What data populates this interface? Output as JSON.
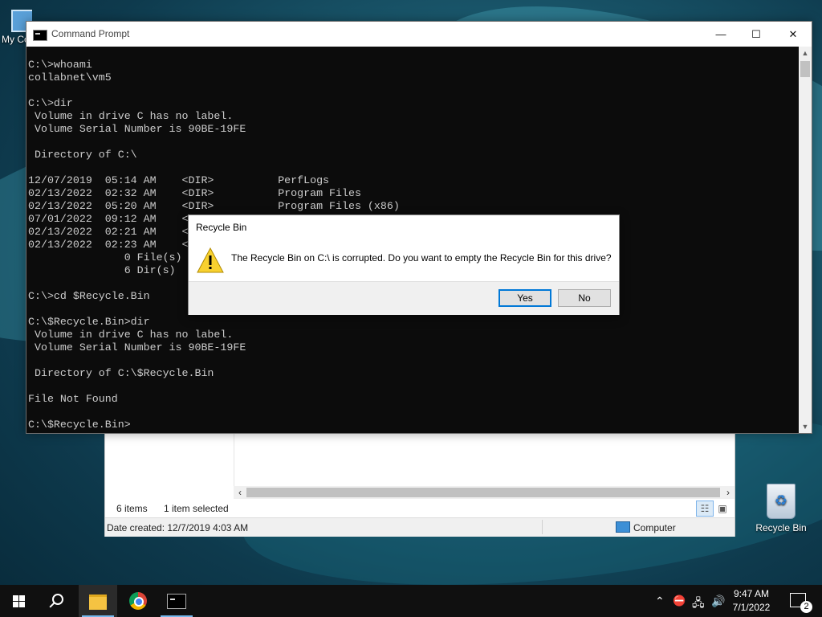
{
  "desktop": {
    "icons": [
      {
        "label": "My Co"
      },
      {
        "label": "Recycle Bin"
      }
    ]
  },
  "explorer": {
    "status_items": "6 items",
    "status_selected": "1 item selected",
    "date_created": "Date created: 12/7/2019 4:03 AM",
    "location": "Computer"
  },
  "cmd": {
    "title": "Command Prompt",
    "console_text": "C:\\>whoami\ncollabnet\\vm5\n\nC:\\>dir\n Volume in drive C has no label.\n Volume Serial Number is 90BE-19FE\n\n Directory of C:\\\n\n12/07/2019  05:14 AM    <DIR>          PerfLogs\n02/13/2022  02:32 AM    <DIR>          Program Files\n02/13/2022  05:20 AM    <DIR>          Program Files (x86)\n07/01/2022  09:12 AM    <\n02/13/2022  02:21 AM    <\n02/13/2022  02:23 AM    <\n               0 File(s)\n               6 Dir(s)\n\nC:\\>cd $Recycle.Bin\n\nC:\\$Recycle.Bin>dir\n Volume in drive C has no label.\n Volume Serial Number is 90BE-19FE\n\n Directory of C:\\$Recycle.Bin\n\nFile Not Found\n\nC:\\$Recycle.Bin>"
  },
  "dialog": {
    "title": "Recycle Bin",
    "message": "The Recycle Bin on C:\\ is corrupted. Do you want to empty the Recycle Bin for this drive?",
    "yes_label": "Yes",
    "no_label": "No"
  },
  "taskbar": {
    "time": "9:47 AM",
    "date": "7/1/2022",
    "notification_count": "2",
    "accent_color": "#76b9ed"
  }
}
